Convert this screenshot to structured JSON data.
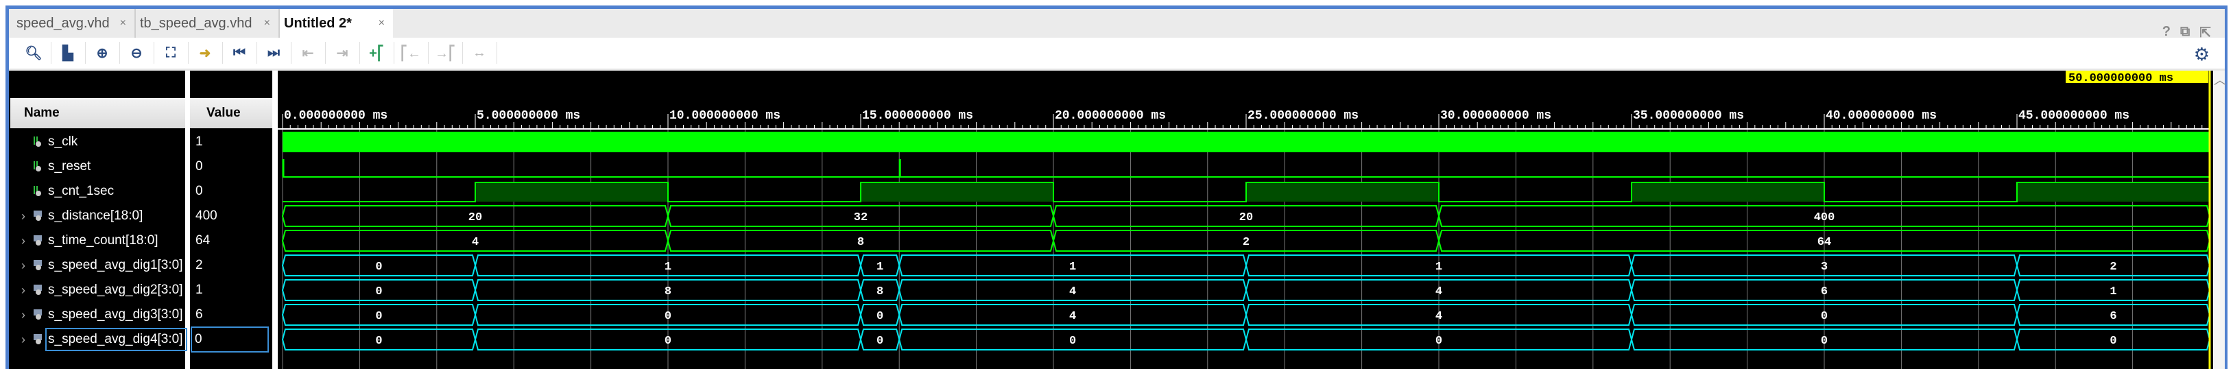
{
  "tabs": [
    {
      "label": "speed_avg.vhd",
      "close": "×"
    },
    {
      "label": "tb_speed_avg.vhd",
      "close": "×"
    },
    {
      "label": "Untitled 2*",
      "close": "×"
    }
  ],
  "window_buttons": {
    "help": "?",
    "restore": "⧉",
    "float": "⇱"
  },
  "toolbar": [
    "search-icon",
    "save-icon",
    "zoom-in-icon",
    "zoom-out-icon",
    "zoom-fit-icon",
    "go-to-cursor-icon",
    "go-to-start-icon",
    "go-to-end-icon",
    "previous-transition-icon",
    "next-transition-icon",
    "add-marker-icon",
    "previous-marker-icon",
    "next-marker-icon",
    "swap-cursors-icon"
  ],
  "headers": {
    "name": "Name",
    "value": "Value"
  },
  "cursor": {
    "label": "50.000000000 ms",
    "time_ms": 50,
    "color": "#ffff00"
  },
  "colors": {
    "logic": "#00ff00",
    "logic_fill": "#004d00",
    "bus": "#00ff00",
    "digit_bus": "#00e5ee",
    "grid": "#7a7a7a"
  },
  "chart_data": {
    "type": "waveform",
    "time_range_ms": [
      0,
      50
    ],
    "ruler_labels": [
      "0.000000000 ms",
      "5.000000000 ms",
      "10.000000000 ms",
      "15.000000000 ms",
      "20.000000000 ms",
      "25.000000000 ms",
      "30.000000000 ms",
      "35.000000000 ms",
      "40.000000000 ms",
      "45.000000000 ms"
    ],
    "signals": [
      {
        "name": "s_clk",
        "value": "1",
        "kind": "clock",
        "expandable": false
      },
      {
        "name": "s_reset",
        "value": "0",
        "kind": "pulse",
        "pulses_ms": [
          0,
          16
        ],
        "expandable": false
      },
      {
        "name": "s_cnt_1sec",
        "value": "0",
        "kind": "logic",
        "high_ms": [
          [
            5,
            10
          ],
          [
            15,
            20
          ],
          [
            25,
            30
          ],
          [
            35,
            40
          ],
          [
            45,
            50
          ]
        ],
        "expandable": false
      },
      {
        "name": "s_distance[18:0]",
        "value": "400",
        "kind": "bus",
        "color": "green",
        "segments": [
          [
            0,
            10,
            "20"
          ],
          [
            10,
            20,
            "32"
          ],
          [
            20,
            30,
            "20"
          ],
          [
            30,
            50,
            "400"
          ]
        ],
        "expandable": true
      },
      {
        "name": "s_time_count[18:0]",
        "value": "64",
        "kind": "bus",
        "color": "green",
        "segments": [
          [
            0,
            10,
            "4"
          ],
          [
            10,
            20,
            "8"
          ],
          [
            20,
            30,
            "2"
          ],
          [
            30,
            50,
            "64"
          ]
        ],
        "expandable": true
      },
      {
        "name": "s_speed_avg_dig1[3:0]",
        "value": "2",
        "kind": "bus",
        "color": "cyan",
        "segments": [
          [
            0,
            5,
            "0"
          ],
          [
            5,
            15,
            "1"
          ],
          [
            15,
            16,
            "1"
          ],
          [
            16,
            25,
            "1"
          ],
          [
            25,
            35,
            "1"
          ],
          [
            35,
            45,
            "3"
          ],
          [
            45,
            50,
            "2"
          ]
        ],
        "expandable": true
      },
      {
        "name": "s_speed_avg_dig2[3:0]",
        "value": "1",
        "kind": "bus",
        "color": "cyan",
        "segments": [
          [
            0,
            5,
            "0"
          ],
          [
            5,
            15,
            "8"
          ],
          [
            15,
            16,
            "8"
          ],
          [
            16,
            25,
            "4"
          ],
          [
            25,
            35,
            "4"
          ],
          [
            35,
            45,
            "6"
          ],
          [
            45,
            50,
            "1"
          ]
        ],
        "expandable": true
      },
      {
        "name": "s_speed_avg_dig3[3:0]",
        "value": "6",
        "kind": "bus",
        "color": "cyan",
        "segments": [
          [
            0,
            5,
            "0"
          ],
          [
            5,
            15,
            "0"
          ],
          [
            15,
            16,
            "0"
          ],
          [
            16,
            25,
            "4"
          ],
          [
            25,
            35,
            "4"
          ],
          [
            35,
            45,
            "0"
          ],
          [
            45,
            50,
            "6"
          ]
        ],
        "expandable": true
      },
      {
        "name": "s_speed_avg_dig4[3:0]",
        "value": "0",
        "kind": "bus",
        "color": "cyan",
        "selected": true,
        "segments": [
          [
            0,
            5,
            "0"
          ],
          [
            5,
            15,
            "0"
          ],
          [
            15,
            16,
            "0"
          ],
          [
            16,
            25,
            "0"
          ],
          [
            25,
            35,
            "0"
          ],
          [
            35,
            45,
            "0"
          ],
          [
            45,
            50,
            "0"
          ]
        ],
        "expandable": true
      }
    ]
  }
}
